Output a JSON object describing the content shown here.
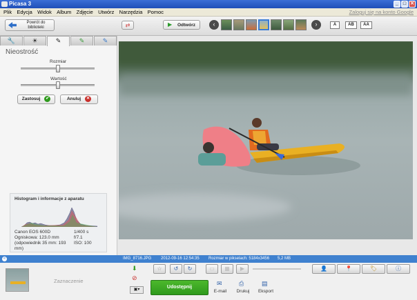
{
  "window": {
    "title": "Picasa 3",
    "minimize": "_",
    "maximize": "□",
    "close": "✕"
  },
  "menu": {
    "items": [
      "Plik",
      "Edycja",
      "Widok",
      "Album",
      "Zdjęcie",
      "Utwórz",
      "Narzędzia",
      "Pomoc"
    ],
    "login_link": "Zaloguj się na konto Google"
  },
  "toolbar": {
    "back_label_line1": "Powrót do",
    "back_label_line2": "biblioteki",
    "open_label": "Odtwórz",
    "view_buttons": [
      "A",
      "AB",
      "AA"
    ]
  },
  "left_panel": {
    "tool_title": "Nieostrość",
    "size_label": "Rozmiar",
    "value_label": "Wartość",
    "size_level": 0.5,
    "value_level": 0.5,
    "apply_label": "Zastosuj",
    "cancel_label": "Anuluj",
    "histogram_title": "Histogram i informacje z aparatu",
    "camera_model": "Canon EOS 600D",
    "focal_length": "Ogniskowa: 123.0 mm",
    "focal_equiv": "(odpowiednik 35 mm: 193 mm)",
    "shutter": "1/400 s",
    "aperture": "f/7.1",
    "iso": "ISO: 100"
  },
  "info_bar": {
    "filename": "IMG_8716.JPG",
    "datetime": "2012-09-16 12:54:35",
    "dimensions": "Rozmiar w pikselach: 5184x3456",
    "filesize": "5,2 MB"
  },
  "bottom": {
    "selection_label": "Zaznaczenie",
    "share_label": "Udostępnij",
    "email_label": "E-mail",
    "print_label": "Drukuj",
    "export_label": "Eksport"
  },
  "colors": {
    "accent": "#3f81cf",
    "share_green": "#2f9a1d",
    "titlebar": "#2a5cc4"
  }
}
